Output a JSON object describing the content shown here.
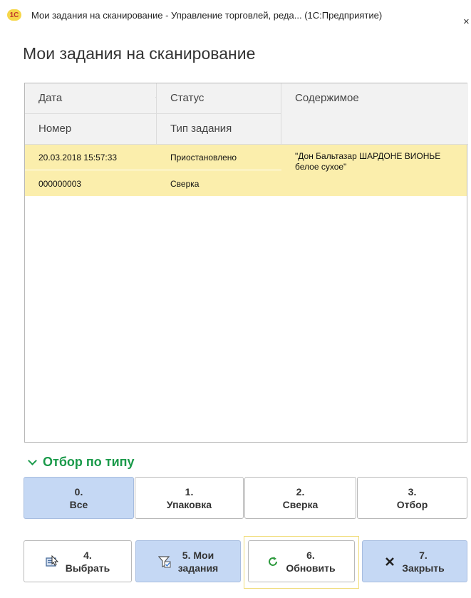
{
  "window": {
    "logo_text": "1С",
    "title": "Мои задания на сканирование - Управление торговлей, реда... (1С:Предприятие)",
    "close_icon": "×"
  },
  "page_title": "Мои задания на сканирование",
  "table": {
    "headers": {
      "date": "Дата",
      "status": "Статус",
      "content": "Содержимое",
      "number": "Номер",
      "task_type": "Тип задания",
      "sort_icon": "↓"
    },
    "rows": [
      {
        "date": "20.03.2018 15:57:33",
        "status": "Приостановлено",
        "content": "\"Дон Бальтазар ШАРДОНЕ ВИОНЬЕ белое сухое\"",
        "number": "000000003",
        "task_type": "Сверка"
      }
    ],
    "selected_row_color": "#fbeeac"
  },
  "filter": {
    "title": "Отбор по типу",
    "buttons": [
      {
        "num": "0.",
        "label": "Все",
        "active": true
      },
      {
        "num": "1.",
        "label": "Упаковка",
        "active": false
      },
      {
        "num": "2.",
        "label": "Сверка",
        "active": false
      },
      {
        "num": "3.",
        "label": "Отбор",
        "active": false
      }
    ]
  },
  "actions": {
    "select": {
      "num": "4.",
      "label": "Выбрать",
      "icon": "select-icon"
    },
    "my_tasks": {
      "num": "5. Мои",
      "label": "задания",
      "icon": "filter-icon"
    },
    "refresh": {
      "num": "6.",
      "label": "Обновить",
      "icon": "refresh-icon"
    },
    "close": {
      "num": "7.",
      "label": "Закрыть",
      "icon": "close-icon"
    }
  },
  "colors": {
    "accent_green": "#1a9a4a",
    "active_button": "#c5d8f4",
    "highlight_row": "#fbeeac"
  }
}
